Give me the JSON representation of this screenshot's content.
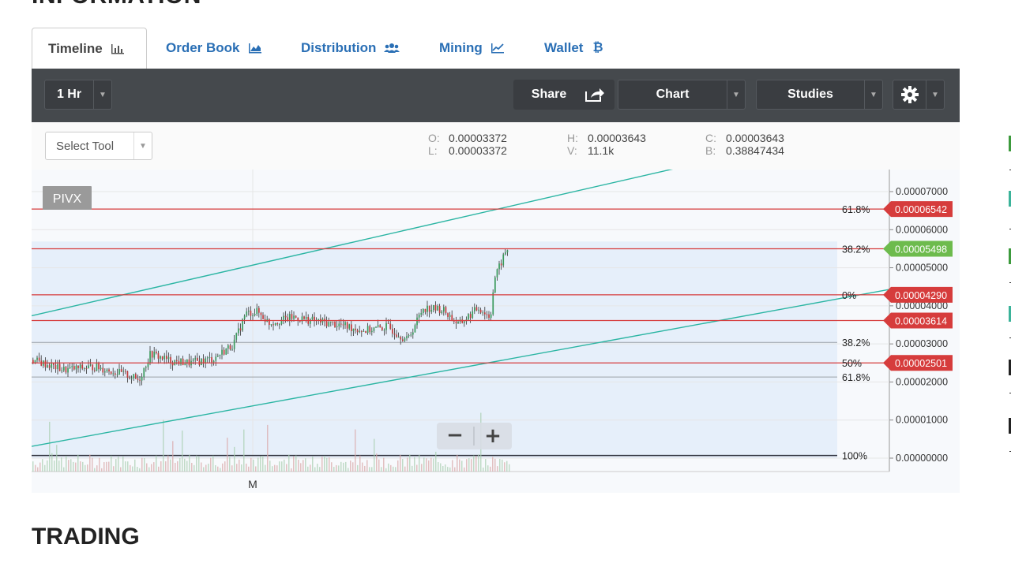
{
  "page": {
    "section_top": "INFORMATION",
    "section_bottom": "TRADING"
  },
  "tabs": [
    {
      "label": "Timeline",
      "icon": "bar-chart-icon",
      "active": true
    },
    {
      "label": "Order Book",
      "icon": "area-chart-icon",
      "active": false
    },
    {
      "label": "Distribution",
      "icon": "users-icon",
      "active": false
    },
    {
      "label": "Mining",
      "icon": "line-chart-icon",
      "active": false
    },
    {
      "label": "Wallet",
      "icon": "bitcoin-icon",
      "active": false
    }
  ],
  "toolbar": {
    "interval": "1 Hr",
    "share": "Share",
    "chart": "Chart",
    "studies": "Studies",
    "settings_icon": "gear-icon"
  },
  "infobar": {
    "select_tool": "Select Tool",
    "ohlc": [
      {
        "k": "O:",
        "v": "0.00003372"
      },
      {
        "k": "L:",
        "v": "0.00003372"
      },
      {
        "k": "H:",
        "v": "0.00003643"
      },
      {
        "k": "V:",
        "v": "11.1k"
      },
      {
        "k": "C:",
        "v": "0.00003643"
      },
      {
        "k": "B:",
        "v": "0.38847434"
      }
    ]
  },
  "chart_data": {
    "type": "candlestick",
    "symbol": "PIVX",
    "x_label": "M",
    "y_axis": {
      "min": 0.0,
      "max": 7e-05,
      "ticks": [
        "0.00007000",
        "0.00006000",
        "0.00005000",
        "0.00004000",
        "0.00003000",
        "0.00002000",
        "0.00001000",
        "0.00000000"
      ]
    },
    "current_price": "0.00005498",
    "price_line_color": "#6dbb4d",
    "level_color": "#d63c3c",
    "red_levels": [
      {
        "value": 6.542e-05,
        "label": "0.00006542",
        "fib": "61.8%"
      },
      {
        "value": 5.498e-05,
        "label": "",
        "fib": "38.2%"
      },
      {
        "value": 4.29e-05,
        "label": "0.00004290",
        "fib": "0%"
      },
      {
        "value": 3.614e-05,
        "label": "0.00003614",
        "fib": ""
      },
      {
        "value": 2.501e-05,
        "label": "0.00002501",
        "fib": "50%"
      }
    ],
    "gray_levels": [
      {
        "value": 3.04e-05,
        "fib": "38.2%"
      },
      {
        "value": 2.13e-05,
        "fib": "61.8%"
      },
      {
        "value": 7e-07,
        "fib": "100%"
      }
    ],
    "trend_lines": [
      {
        "from": [
          0,
          3.74e-05
        ],
        "to": [
          0.84,
          8.07e-05
        ]
      },
      {
        "from": [
          0,
          3.1e-06
        ],
        "to": [
          1.0,
          4.43e-05
        ]
      }
    ],
    "trend_color": "#2bb5a3",
    "zoom_out": "−",
    "zoom_in": "+"
  }
}
